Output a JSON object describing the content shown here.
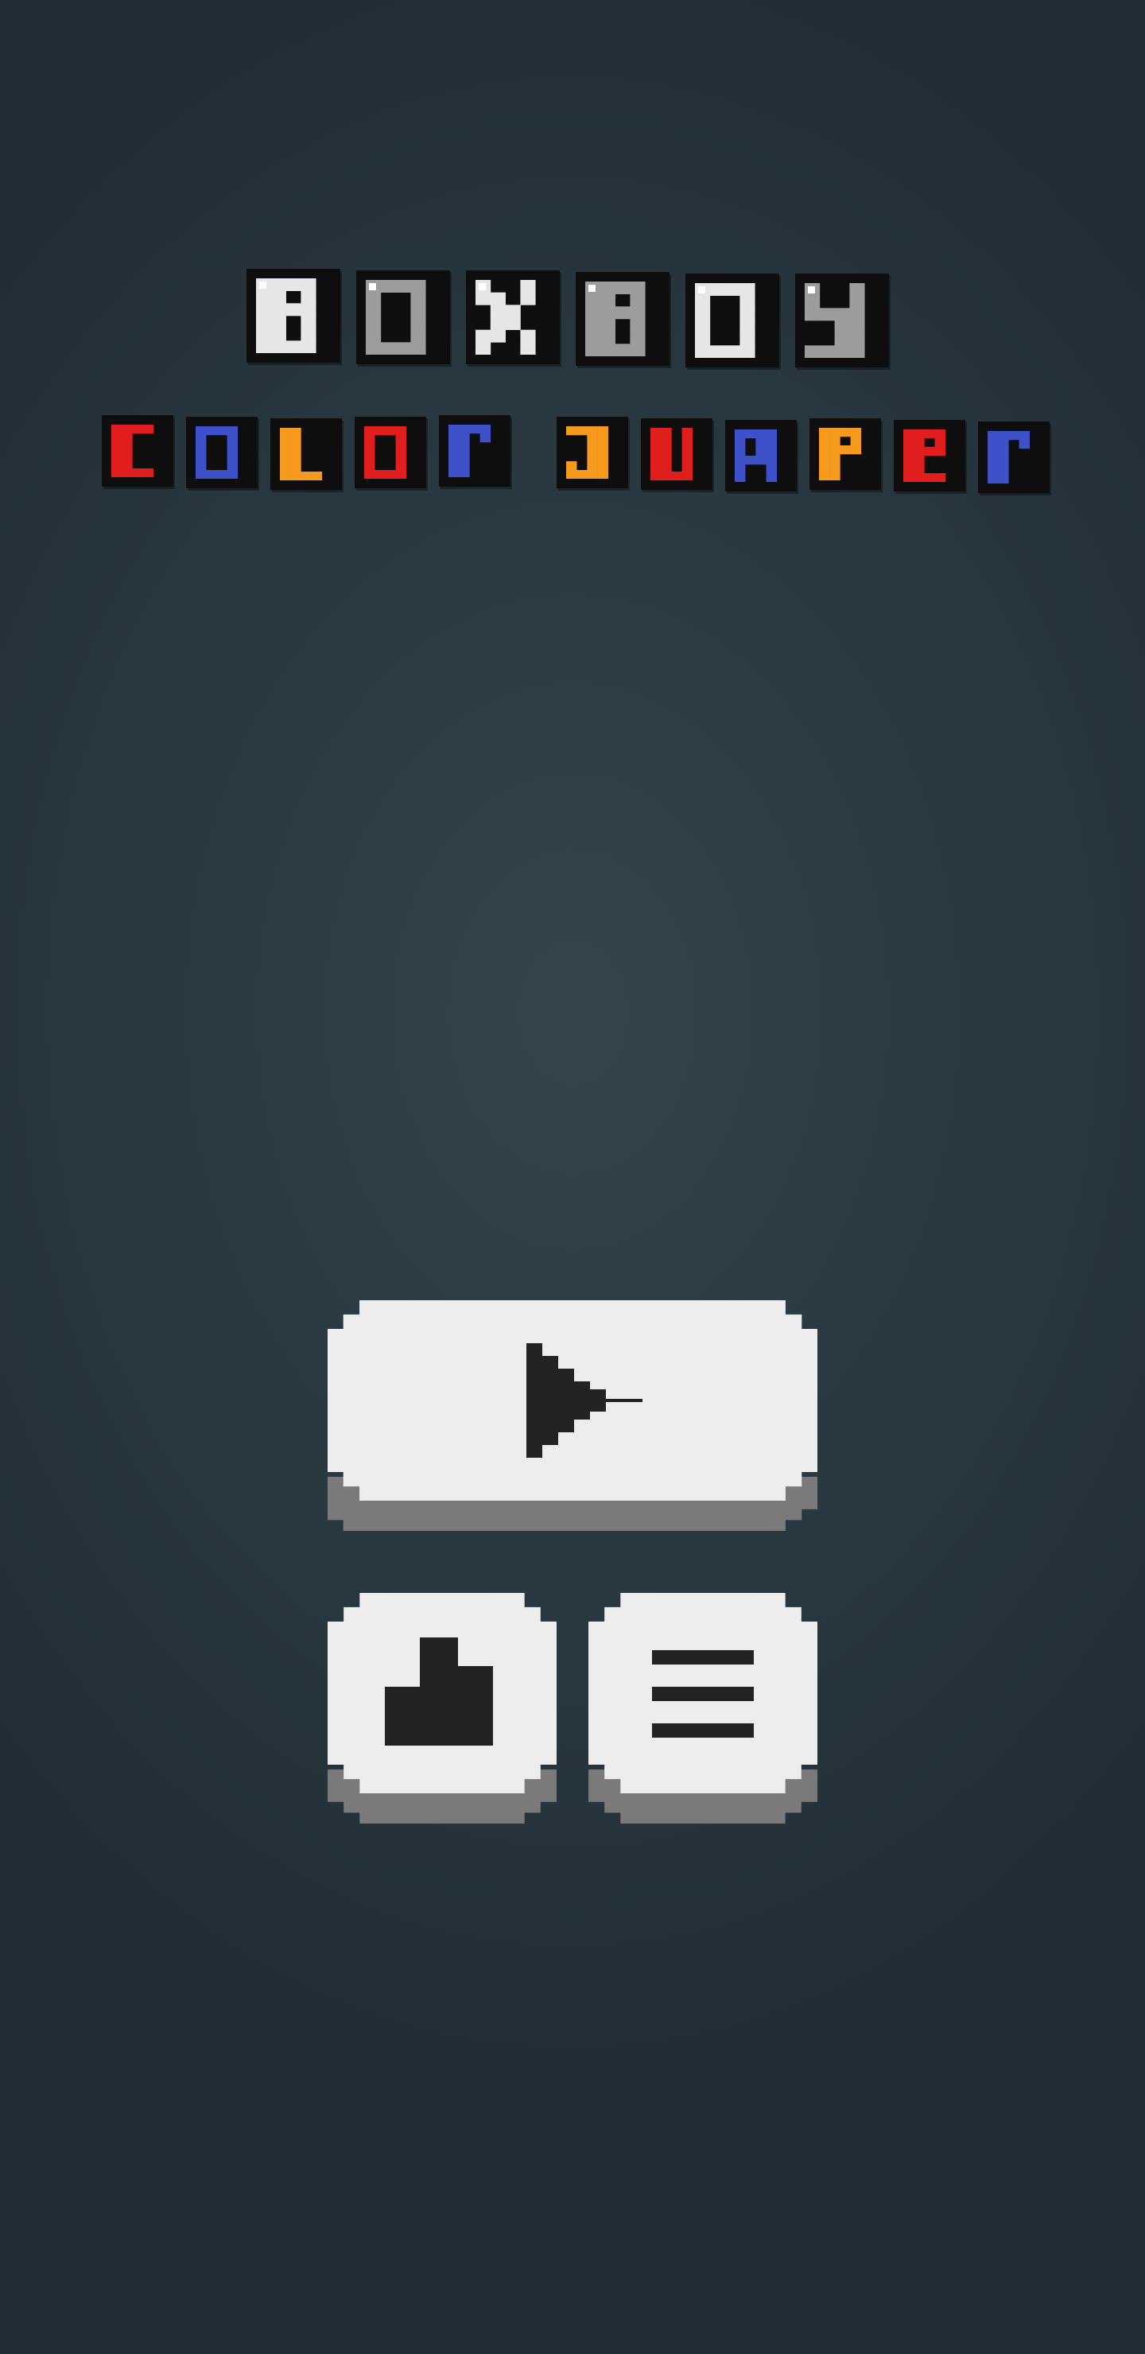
{
  "game": {
    "title_line1": "BOXBOY",
    "title_line2": "COLOR JUMPER"
  },
  "title_line1_tiles": [
    {
      "letter": "B",
      "color": "#e6e6e6"
    },
    {
      "letter": "O",
      "color": "#9c9c9c"
    },
    {
      "letter": "X",
      "color": "#e6e6e6"
    },
    {
      "letter": "B",
      "color": "#9c9c9c"
    },
    {
      "letter": "O",
      "color": "#e6e6e6"
    },
    {
      "letter": "Y",
      "color": "#9c9c9c"
    }
  ],
  "title_line2_tiles": [
    {
      "letter": "C",
      "color": "#e11e1e"
    },
    {
      "letter": "O",
      "color": "#3f51c9"
    },
    {
      "letter": "L",
      "color": "#f59a1c"
    },
    {
      "letter": "O",
      "color": "#e11e1e"
    },
    {
      "letter": "R",
      "color": "#3f51c9"
    },
    {
      "letter": "J",
      "color": "#f59a1c"
    },
    {
      "letter": "U",
      "color": "#e11e1e"
    },
    {
      "letter": "M",
      "color": "#3f51c9"
    },
    {
      "letter": "P",
      "color": "#f59a1c"
    },
    {
      "letter": "E",
      "color": "#e11e1e"
    },
    {
      "letter": "R",
      "color": "#3f51c9"
    }
  ],
  "colors": {
    "background_center": "#34454d",
    "background_edge": "#222e36",
    "tile_border": "#0e0e0e",
    "button_face": "#ededed",
    "button_shadow": "#7a7a7a",
    "icon": "#222222"
  },
  "buttons": {
    "play": {
      "icon": "play-icon"
    },
    "leaderboard": {
      "icon": "leaderboard-icon"
    },
    "menu": {
      "icon": "hamburger-menu-icon"
    }
  }
}
